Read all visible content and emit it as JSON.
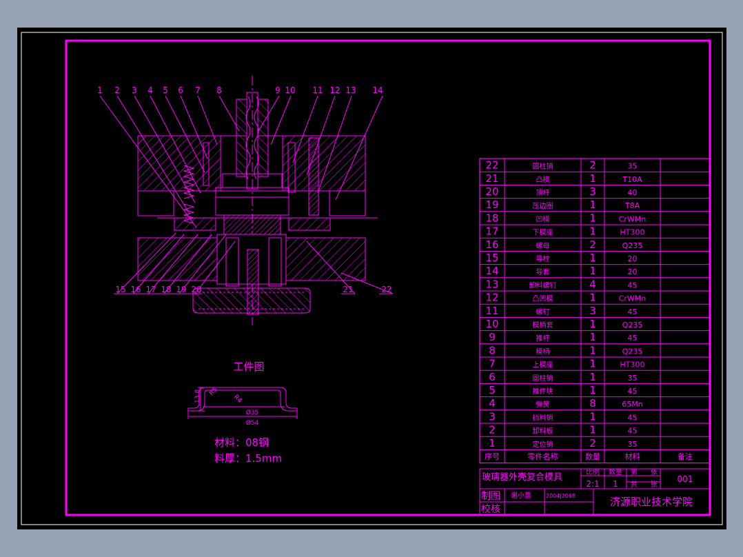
{
  "colors": {
    "background": "#96a3b4",
    "sheet": "#000000",
    "line": "#ff00ff",
    "frame_outer": "#ffffff"
  },
  "callouts_top": [
    "1",
    "2",
    "3",
    "4",
    "5",
    "6",
    "7",
    "8",
    "9",
    "10",
    "11",
    "12",
    "13",
    "14"
  ],
  "callouts_bottom_left": [
    "15",
    "16",
    "17",
    "18",
    "19",
    "20"
  ],
  "callouts_bottom_right": [
    "21",
    "22"
  ],
  "workpiece": {
    "title": "工件图",
    "dim_height": "13.8",
    "dim_r1": "R5",
    "dim_r2": "R4",
    "dim_d1": "Ø35",
    "dim_d2": "Ø54",
    "material": "材料：08钢",
    "thickness": "料厚：1.5mm"
  },
  "bom": [
    {
      "no": "22",
      "name": "圆柱销",
      "qty": "2",
      "material": "35",
      "note": ""
    },
    {
      "no": "21",
      "name": "凸模",
      "qty": "1",
      "material": "T10A",
      "note": ""
    },
    {
      "no": "20",
      "name": "顶杆",
      "qty": "3",
      "material": "40",
      "note": ""
    },
    {
      "no": "19",
      "name": "压边圈",
      "qty": "1",
      "material": "T8A",
      "note": ""
    },
    {
      "no": "18",
      "name": "凹模",
      "qty": "1",
      "material": "CrWMn",
      "note": ""
    },
    {
      "no": "17",
      "name": "下模座",
      "qty": "1",
      "material": "HT300",
      "note": ""
    },
    {
      "no": "16",
      "name": "螺母",
      "qty": "2",
      "material": "Q235",
      "note": ""
    },
    {
      "no": "15",
      "name": "导柱",
      "qty": "1",
      "material": "20",
      "note": ""
    },
    {
      "no": "14",
      "name": "导套",
      "qty": "1",
      "material": "20",
      "note": ""
    },
    {
      "no": "13",
      "name": "卸料螺钉",
      "qty": "4",
      "material": "45",
      "note": ""
    },
    {
      "no": "12",
      "name": "凸凹模",
      "qty": "1",
      "material": "CrWMn",
      "note": ""
    },
    {
      "no": "11",
      "name": "螺钉",
      "qty": "3",
      "material": "45",
      "note": ""
    },
    {
      "no": "10",
      "name": "模柄套",
      "qty": "1",
      "material": "Q235",
      "note": ""
    },
    {
      "no": "9",
      "name": "推杆",
      "qty": "1",
      "material": "45",
      "note": ""
    },
    {
      "no": "8",
      "name": "模柄",
      "qty": "1",
      "material": "Q235",
      "note": ""
    },
    {
      "no": "7",
      "name": "上模座",
      "qty": "1",
      "material": "HT300",
      "note": ""
    },
    {
      "no": "6",
      "name": "圆柱销",
      "qty": "1",
      "material": "35",
      "note": ""
    },
    {
      "no": "5",
      "name": "推件块",
      "qty": "1",
      "material": "45",
      "note": ""
    },
    {
      "no": "4",
      "name": "弹簧",
      "qty": "8",
      "material": "65Mn",
      "note": ""
    },
    {
      "no": "3",
      "name": "挡料销",
      "qty": "1",
      "material": "45",
      "note": ""
    },
    {
      "no": "2",
      "name": "卸料板",
      "qty": "1",
      "material": "45",
      "note": ""
    },
    {
      "no": "1",
      "name": "定位销",
      "qty": "2",
      "material": "35",
      "note": ""
    }
  ],
  "bom_header": {
    "no": "序号",
    "name": "零件名称",
    "qty": "数量",
    "material": "材料",
    "note": "备注"
  },
  "title_block": {
    "title": "玻璃器外壳复合模具",
    "scale_label": "比例",
    "qty_label": "数量",
    "sheet_label": "第",
    "sheet_unit": "张",
    "total_label": "共",
    "total_unit": "张",
    "scale_value": "2:1",
    "qty_value": "1",
    "drawing_no": "001",
    "drawn_label": "制图",
    "drawn_name": "谢小蕾",
    "drawn_id": "2004J2068",
    "check_label": "校核",
    "school": "济源职业技术学院"
  }
}
